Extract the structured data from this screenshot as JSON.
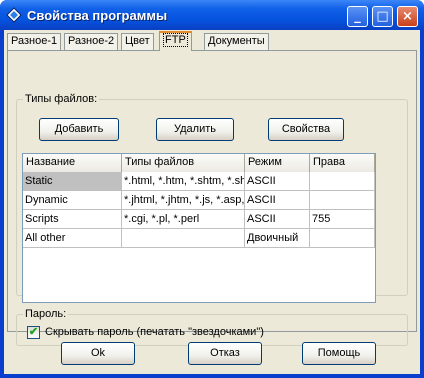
{
  "window": {
    "title": "Свойства программы",
    "buttons": {
      "minimize": "_",
      "maximize": "□",
      "close": "×"
    }
  },
  "tabs": [
    {
      "label": "Разное-1",
      "active": false
    },
    {
      "label": "Разное-2",
      "active": false
    },
    {
      "label": "Цвет",
      "active": false
    },
    {
      "label": "FTP",
      "active": true
    },
    {
      "label": "Документы",
      "active": false
    }
  ],
  "file_types": {
    "group_label": "Типы файлов:",
    "add_button": "Добавить",
    "delete_button": "Удалить",
    "properties_button": "Свойства",
    "columns": [
      "Название",
      "Типы файлов",
      "Режим",
      "Права"
    ],
    "rows": [
      [
        "Static",
        "*.html, *.htm, *.shtm, *.shtml",
        "ASCII",
        ""
      ],
      [
        "Dynamic",
        "*.jhtml, *.jhtm, *.js, *.asp, *.",
        "ASCII",
        ""
      ],
      [
        "Scripts",
        "*.cgi, *.pl, *.perl",
        "ASCII",
        "755"
      ],
      [
        "All other",
        "",
        "Двоичный",
        ""
      ]
    ],
    "selected_row": 0
  },
  "password": {
    "group_label": "Пароль:",
    "hide_checkbox_label": "Скрывать пароль (печатать \"звездочками\")",
    "hide_checked": true
  },
  "footer": {
    "ok": "Ok",
    "cancel": "Отказ",
    "help": "Помощь"
  },
  "colors": {
    "titlebar": "#0a3fce",
    "client": "#ece9d8",
    "active_tab_accent": "#e68b2c",
    "selected_cell": "#c0c0c0"
  }
}
